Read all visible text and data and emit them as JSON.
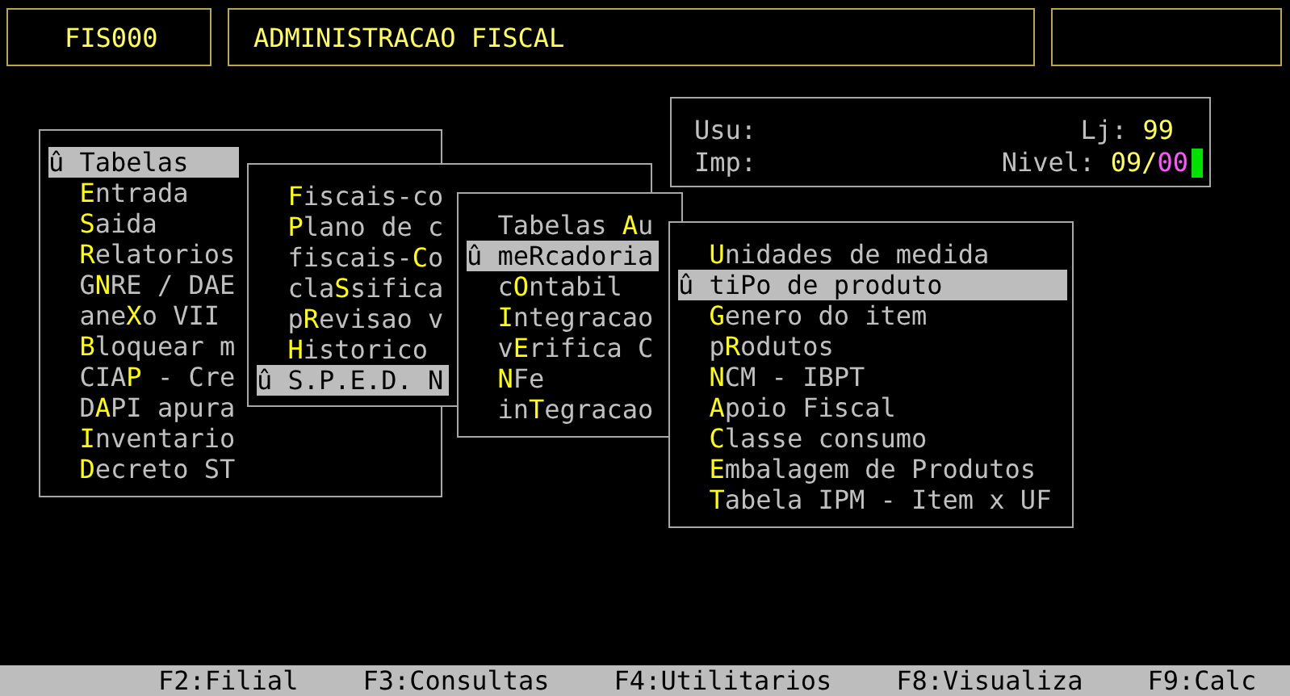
{
  "header": {
    "code": "FIS000",
    "title": "ADMINISTRACAO FISCAL"
  },
  "info": {
    "user_label": "Usu:",
    "printer_label": "Imp:",
    "store_label": "Lj:",
    "store_value": "99",
    "level_label": "Nivel:",
    "level_value": "09/",
    "level_suffix": "00"
  },
  "menus": [
    {
      "items": [
        {
          "selected": true,
          "marker": "û",
          "label": "Tabelas"
        },
        {
          "selected": false,
          "segments": [
            {
              "text": "E",
              "hotkey": true
            },
            {
              "text": "ntrada",
              "hotkey": false
            }
          ]
        },
        {
          "selected": false,
          "segments": [
            {
              "text": "S",
              "hotkey": true
            },
            {
              "text": "aida",
              "hotkey": false
            }
          ]
        },
        {
          "selected": false,
          "segments": [
            {
              "text": "R",
              "hotkey": true
            },
            {
              "text": "elatorios",
              "hotkey": false
            }
          ]
        },
        {
          "selected": false,
          "segments": [
            {
              "text": "G",
              "hotkey": false
            },
            {
              "text": "N",
              "hotkey": true
            },
            {
              "text": "RE / DAE",
              "hotkey": false
            }
          ]
        },
        {
          "selected": false,
          "segments": [
            {
              "text": "ane",
              "hotkey": false
            },
            {
              "text": "X",
              "hotkey": true
            },
            {
              "text": "o VII",
              "hotkey": false
            }
          ]
        },
        {
          "selected": false,
          "segments": [
            {
              "text": "B",
              "hotkey": true
            },
            {
              "text": "loquear m",
              "hotkey": false
            }
          ]
        },
        {
          "selected": false,
          "segments": [
            {
              "text": "CIA",
              "hotkey": false
            },
            {
              "text": "P",
              "hotkey": true
            },
            {
              "text": " - Cre",
              "hotkey": false
            }
          ]
        },
        {
          "selected": false,
          "segments": [
            {
              "text": "D",
              "hotkey": false
            },
            {
              "text": "A",
              "hotkey": true
            },
            {
              "text": "PI apura",
              "hotkey": false
            }
          ]
        },
        {
          "selected": false,
          "segments": [
            {
              "text": "I",
              "hotkey": true
            },
            {
              "text": "nventario",
              "hotkey": false
            }
          ]
        },
        {
          "selected": false,
          "segments": [
            {
              "text": "D",
              "hotkey": true
            },
            {
              "text": "ecreto ST",
              "hotkey": false
            }
          ]
        }
      ]
    },
    {
      "items": [
        {
          "selected": false,
          "segments": [
            {
              "text": "F",
              "hotkey": true
            },
            {
              "text": "iscais-co",
              "hotkey": false
            }
          ]
        },
        {
          "selected": false,
          "segments": [
            {
              "text": "P",
              "hotkey": true
            },
            {
              "text": "lano de c",
              "hotkey": false
            }
          ]
        },
        {
          "selected": false,
          "segments": [
            {
              "text": "fiscais-",
              "hotkey": false
            },
            {
              "text": "C",
              "hotkey": true
            },
            {
              "text": "o",
              "hotkey": false
            }
          ]
        },
        {
          "selected": false,
          "segments": [
            {
              "text": "cla",
              "hotkey": false
            },
            {
              "text": "S",
              "hotkey": true
            },
            {
              "text": "sifica",
              "hotkey": false
            }
          ]
        },
        {
          "selected": false,
          "segments": [
            {
              "text": "p",
              "hotkey": false
            },
            {
              "text": "R",
              "hotkey": true
            },
            {
              "text": "evisao v",
              "hotkey": false
            }
          ]
        },
        {
          "selected": false,
          "segments": [
            {
              "text": "H",
              "hotkey": true
            },
            {
              "text": "istorico",
              "hotkey": false
            }
          ]
        },
        {
          "selected": true,
          "marker": "û",
          "label": "S.P.E.D. N"
        }
      ]
    },
    {
      "items": [
        {
          "selected": false,
          "segments": [
            {
              "text": "Tabelas ",
              "hotkey": false
            },
            {
              "text": "A",
              "hotkey": true
            },
            {
              "text": "u",
              "hotkey": false
            }
          ]
        },
        {
          "selected": true,
          "marker": "û",
          "label": "meRcadoria"
        },
        {
          "selected": false,
          "segments": [
            {
              "text": "c",
              "hotkey": false
            },
            {
              "text": "O",
              "hotkey": true
            },
            {
              "text": "ntabil",
              "hotkey": false
            }
          ]
        },
        {
          "selected": false,
          "segments": [
            {
              "text": "I",
              "hotkey": true
            },
            {
              "text": "ntegracao",
              "hotkey": false
            }
          ]
        },
        {
          "selected": false,
          "segments": [
            {
              "text": "v",
              "hotkey": false
            },
            {
              "text": "E",
              "hotkey": true
            },
            {
              "text": "rifica C",
              "hotkey": false
            }
          ]
        },
        {
          "selected": false,
          "segments": [
            {
              "text": "N",
              "hotkey": true
            },
            {
              "text": "Fe",
              "hotkey": false
            }
          ]
        },
        {
          "selected": false,
          "segments": [
            {
              "text": "in",
              "hotkey": false
            },
            {
              "text": "T",
              "hotkey": true
            },
            {
              "text": "egracao",
              "hotkey": false
            }
          ]
        }
      ]
    },
    {
      "items": [
        {
          "selected": false,
          "segments": [
            {
              "text": "U",
              "hotkey": true
            },
            {
              "text": "nidades de medida",
              "hotkey": false
            }
          ]
        },
        {
          "selected": true,
          "marker": "û",
          "label": "tiPo de produto"
        },
        {
          "selected": false,
          "segments": [
            {
              "text": "G",
              "hotkey": true
            },
            {
              "text": "enero do item",
              "hotkey": false
            }
          ]
        },
        {
          "selected": false,
          "segments": [
            {
              "text": "p",
              "hotkey": false
            },
            {
              "text": "R",
              "hotkey": true
            },
            {
              "text": "odutos",
              "hotkey": false
            }
          ]
        },
        {
          "selected": false,
          "segments": [
            {
              "text": "N",
              "hotkey": true
            },
            {
              "text": "CM - IBPT",
              "hotkey": false
            }
          ]
        },
        {
          "selected": false,
          "segments": [
            {
              "text": "A",
              "hotkey": true
            },
            {
              "text": "poio Fiscal",
              "hotkey": false
            }
          ]
        },
        {
          "selected": false,
          "segments": [
            {
              "text": "C",
              "hotkey": true
            },
            {
              "text": "lasse consumo",
              "hotkey": false
            }
          ]
        },
        {
          "selected": false,
          "segments": [
            {
              "text": "E",
              "hotkey": true
            },
            {
              "text": "mbalagem de Produtos",
              "hotkey": false
            }
          ]
        },
        {
          "selected": false,
          "segments": [
            {
              "text": "T",
              "hotkey": true
            },
            {
              "text": "abela IPM - Item x UF",
              "hotkey": false
            }
          ]
        }
      ]
    }
  ],
  "status_bar": [
    "F2:Filial",
    "F3:Consultas",
    "F4:Utilitarios",
    "F8:Visualiza",
    "F9:Calc"
  ]
}
